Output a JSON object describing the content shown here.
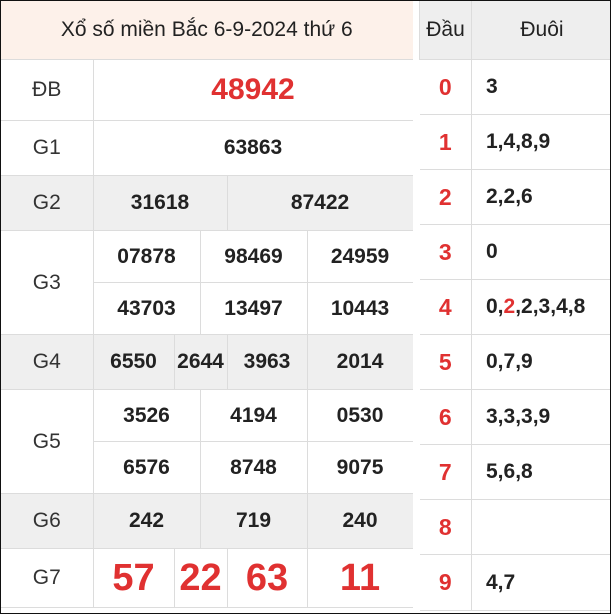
{
  "title": "Xổ số miền Bắc 6-9-2024 thứ 6",
  "results": {
    "db": {
      "label": "ĐB",
      "value": "48942"
    },
    "g1": {
      "label": "G1",
      "values": [
        "63863"
      ]
    },
    "g2": {
      "label": "G2",
      "values": [
        "31618",
        "87422"
      ]
    },
    "g3": {
      "label": "G3",
      "values": [
        "07878",
        "98469",
        "24959",
        "43703",
        "13497",
        "10443"
      ]
    },
    "g4": {
      "label": "G4",
      "values": [
        "6550",
        "2644",
        "3963",
        "2014"
      ]
    },
    "g5": {
      "label": "G5",
      "values": [
        "3526",
        "4194",
        "0530",
        "6576",
        "8748",
        "9075"
      ]
    },
    "g6": {
      "label": "G6",
      "values": [
        "242",
        "719",
        "240"
      ]
    },
    "g7": {
      "label": "G7",
      "values": [
        "57",
        "22",
        "63",
        "11"
      ]
    }
  },
  "loto": {
    "head_dau": "Đầu",
    "head_duoi": "Đuôi",
    "rows": [
      {
        "dau": "0",
        "duoi": "3"
      },
      {
        "dau": "1",
        "duoi": "1,4,8,9"
      },
      {
        "dau": "2",
        "duoi": "2,2,6"
      },
      {
        "dau": "3",
        "duoi": "0"
      },
      {
        "dau": "4",
        "duoi_pre": "0,",
        "duoi_hl": "2",
        "duoi_post": ",2,3,4,8"
      },
      {
        "dau": "5",
        "duoi": "0,7,9"
      },
      {
        "dau": "6",
        "duoi": "3,3,3,9"
      },
      {
        "dau": "7",
        "duoi": "5,6,8"
      },
      {
        "dau": "8",
        "duoi": ""
      },
      {
        "dau": "9",
        "duoi": "4,7"
      }
    ]
  }
}
